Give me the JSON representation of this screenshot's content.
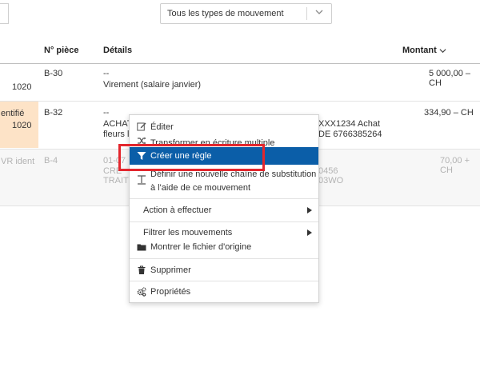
{
  "filter": {
    "movement_type_selected": "Tous les types de mouvement"
  },
  "table": {
    "headers": {
      "piece": "N° pièce",
      "details": "Détails",
      "amount": "Montant"
    },
    "rows": [
      {
        "left_text": "1020",
        "piece": "B-30",
        "details_line1": "--",
        "details_line2": "Virement (salaire janvier)",
        "amount": "5 000,00 – CH"
      },
      {
        "left_line1": "entifié",
        "left_line2": "1020",
        "piece": "B-32",
        "details_line1": "--",
        "details_line2_a": "ACHAT",
        "details_line2_b": "XXX1234 Achat",
        "details_line3_a": "fleurs l",
        "details_line3_b": "DE 6766385264",
        "amount": "334,90 – CH"
      },
      {
        "left_line1": "VR ident",
        "left_line2": "",
        "piece": "B-4",
        "details_line1": "01-07",
        "details_line1_b": "0456",
        "details_line2": "CRE",
        "details_line3": "TRAIT",
        "details_line3_b": "03WO",
        "amount": "70,00 + CH"
      }
    ]
  },
  "context_menu": {
    "edit": "Éditer",
    "transform": "Transformer en écriture multiple",
    "create_rule": "Créer une règle",
    "define_chain_line1": "Définir une nouvelle chaîne de substitution",
    "define_chain_line2": "à l'aide de ce mouvement",
    "action": "Action à effectuer",
    "filter": "Filtrer les mouvements",
    "show_file": "Montrer le fichier d'origine",
    "delete": "Supprimer",
    "properties": "Propriétés"
  },
  "colors": {
    "menu_active_bg": "#0b5ea8",
    "highlight_box": "#e3262d",
    "row_highlight": "#fde3c7"
  },
  "icons": {
    "edit": "pencil-square-icon",
    "transform": "shuffle-icon",
    "create_rule": "filter-funnel-icon",
    "define_chain": "text-cursor-icon",
    "show_file": "folder-icon",
    "delete": "trash-icon",
    "properties": "gears-icon",
    "sort": "chevron-down-icon"
  }
}
